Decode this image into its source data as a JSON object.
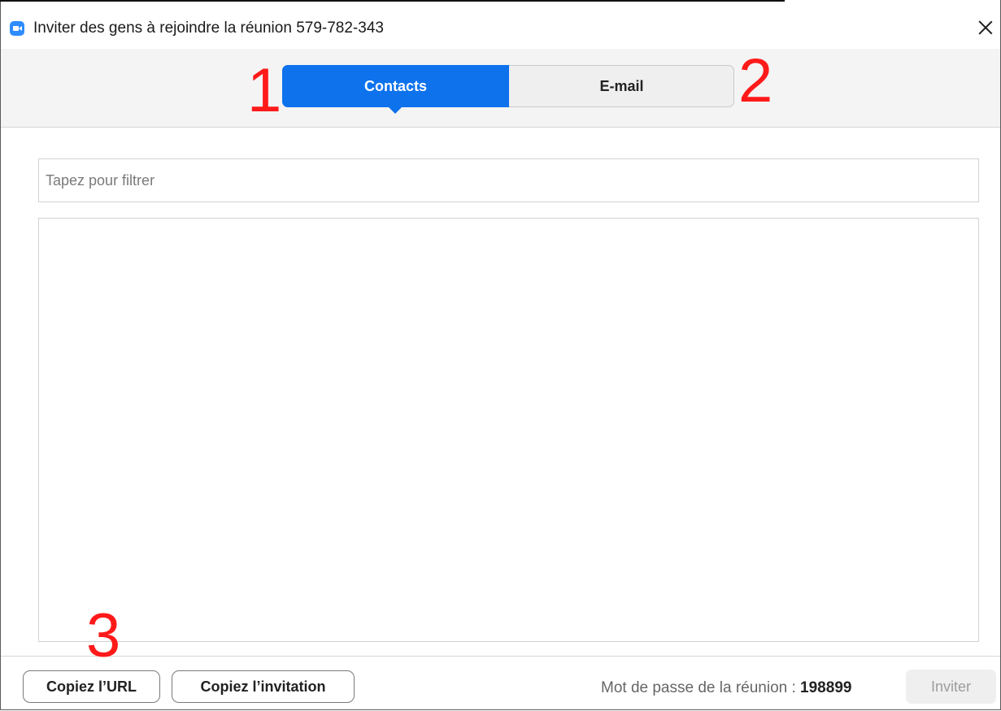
{
  "window": {
    "title": "Inviter des gens à rejoindre la réunion 579-782-343",
    "app_icon": "zoom-camera-icon",
    "close_icon": "close-icon"
  },
  "tabs": [
    {
      "label": "Contacts",
      "active": true
    },
    {
      "label": "E-mail",
      "active": false
    }
  ],
  "annotations": [
    "1",
    "2",
    "3"
  ],
  "filter": {
    "placeholder": "Tapez pour filtrer",
    "value": ""
  },
  "contacts": [],
  "footer": {
    "copy_url_label": "Copiez l’URL",
    "copy_invitation_label": "Copiez l’invitation",
    "password_label": "Mot de passe de la réunion :",
    "password_value": "198899",
    "invite_label": "Inviter"
  },
  "colors": {
    "accent": "#0e72ed",
    "annotation": "#ff1a1a",
    "app_icon": "#2d8cff"
  }
}
